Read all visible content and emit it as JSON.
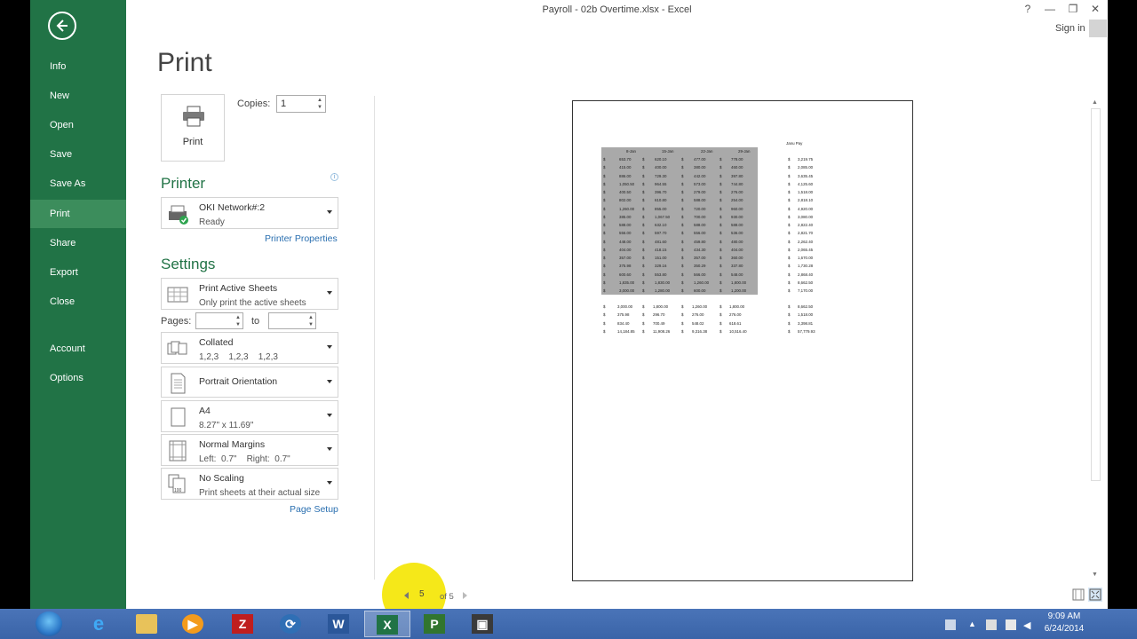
{
  "window": {
    "title": "Payroll - 02b Overtime.xlsx - Excel",
    "help": "?",
    "minimize": "—",
    "restore": "❐",
    "close": "✕",
    "sign_in": "Sign in"
  },
  "backstage": {
    "items": [
      {
        "label": "Info"
      },
      {
        "label": "New"
      },
      {
        "label": "Open"
      },
      {
        "label": "Save"
      },
      {
        "label": "Save As"
      },
      {
        "label": "Print"
      },
      {
        "label": "Share"
      },
      {
        "label": "Export"
      },
      {
        "label": "Close"
      },
      {
        "label": "Account"
      },
      {
        "label": "Options"
      }
    ],
    "active": "Print"
  },
  "print": {
    "heading": "Print",
    "print_button": "Print",
    "copies_label": "Copies:",
    "copies_value": "1",
    "printer_section": "Printer",
    "printer_name": "OKI Network#:2",
    "printer_status": "Ready",
    "printer_properties": "Printer Properties",
    "settings_section": "Settings",
    "what": {
      "main": "Print Active Sheets",
      "sub": "Only print the active sheets"
    },
    "pages_label": "Pages:",
    "to_label": "to",
    "collate": {
      "main": "Collated",
      "sub": "1,2,3    1,2,3    1,2,3"
    },
    "orientation": {
      "main": "Portrait Orientation"
    },
    "paper": {
      "main": "A4",
      "sub": "8.27\" x 11.69\""
    },
    "margins": {
      "main": "Normal Margins",
      "sub": "Left:  0.7\"    Right:  0.7\""
    },
    "scaling": {
      "main": "No Scaling",
      "sub": "Print sheets at their actual size"
    },
    "page_setup": "Page Setup"
  },
  "preview": {
    "current_page": "5",
    "of_pages": "of 5",
    "col_headers": [
      "8-Jan",
      "15-Jan",
      "22-Jan",
      "29-Jan"
    ],
    "jan_header": "Janu Pay",
    "rows": [
      [
        "653.70",
        "620.10",
        "477.00",
        "778.00",
        "3,219.75"
      ],
      [
        "415.00",
        "400.00",
        "380.00",
        "460.00",
        "2,085.00"
      ],
      [
        "886.00",
        "729.30",
        "442.00",
        "397.80",
        "3,635.45"
      ],
      [
        "1,050.50",
        "964.55",
        "573.00",
        "744.80",
        "4,125.60"
      ],
      [
        "400.50",
        "396.70",
        "279.00",
        "276.00",
        "1,518.00"
      ],
      [
        "802.00",
        "610.80",
        "588.00",
        "254.00",
        "2,818.10"
      ],
      [
        "1,260.00",
        "855.00",
        "720.00",
        "960.00",
        "4,920.00"
      ],
      [
        "385.00",
        "1,067.50",
        "700.00",
        "930.00",
        "3,080.00"
      ],
      [
        "588.00",
        "632.10",
        "588.00",
        "588.00",
        "2,822.40"
      ],
      [
        "556.00",
        "597.70",
        "556.00",
        "536.00",
        "2,821.70"
      ],
      [
        "448.00",
        "481.60",
        "459.80",
        "480.00",
        "2,262.40"
      ],
      [
        "404.00",
        "418.15",
        "434.30",
        "404.00",
        "2,065.45"
      ],
      [
        "357.00",
        "151.00",
        "357.00",
        "360.00",
        "1,670.00"
      ],
      [
        "375.98",
        "329.16",
        "350.29",
        "337.80",
        "1,730.28"
      ],
      [
        "600.60",
        "553.80",
        "566.00",
        "548.00",
        "2,868.40"
      ],
      [
        "1,835.00",
        "1,830.00",
        "1,260.00",
        "1,800.00",
        "8,662.50"
      ],
      [
        "3,000.00",
        "1,280.00",
        "600.00",
        "1,200.00",
        "7,170.00"
      ]
    ],
    "summary": [
      [
        "3,000.00",
        "1,800.00",
        "1,260.00",
        "1,800.00",
        "8,662.50"
      ],
      [
        "375.98",
        "296.70",
        "276.00",
        "276.00",
        "1,518.00"
      ],
      [
        "834.40",
        "700.49",
        "548.02",
        "618.61",
        "3,398.81"
      ],
      [
        "14,184.85",
        "11,908.26",
        "9,316.38",
        "10,516.40",
        "57,779.93"
      ]
    ],
    "dollar": "$"
  },
  "taskbar": {
    "time": "9:09 AM",
    "date": "6/24/2014"
  },
  "colors": {
    "excel_green": "#217346",
    "active_nav": "#3c8d5c",
    "link_blue": "#2a6fb0"
  }
}
